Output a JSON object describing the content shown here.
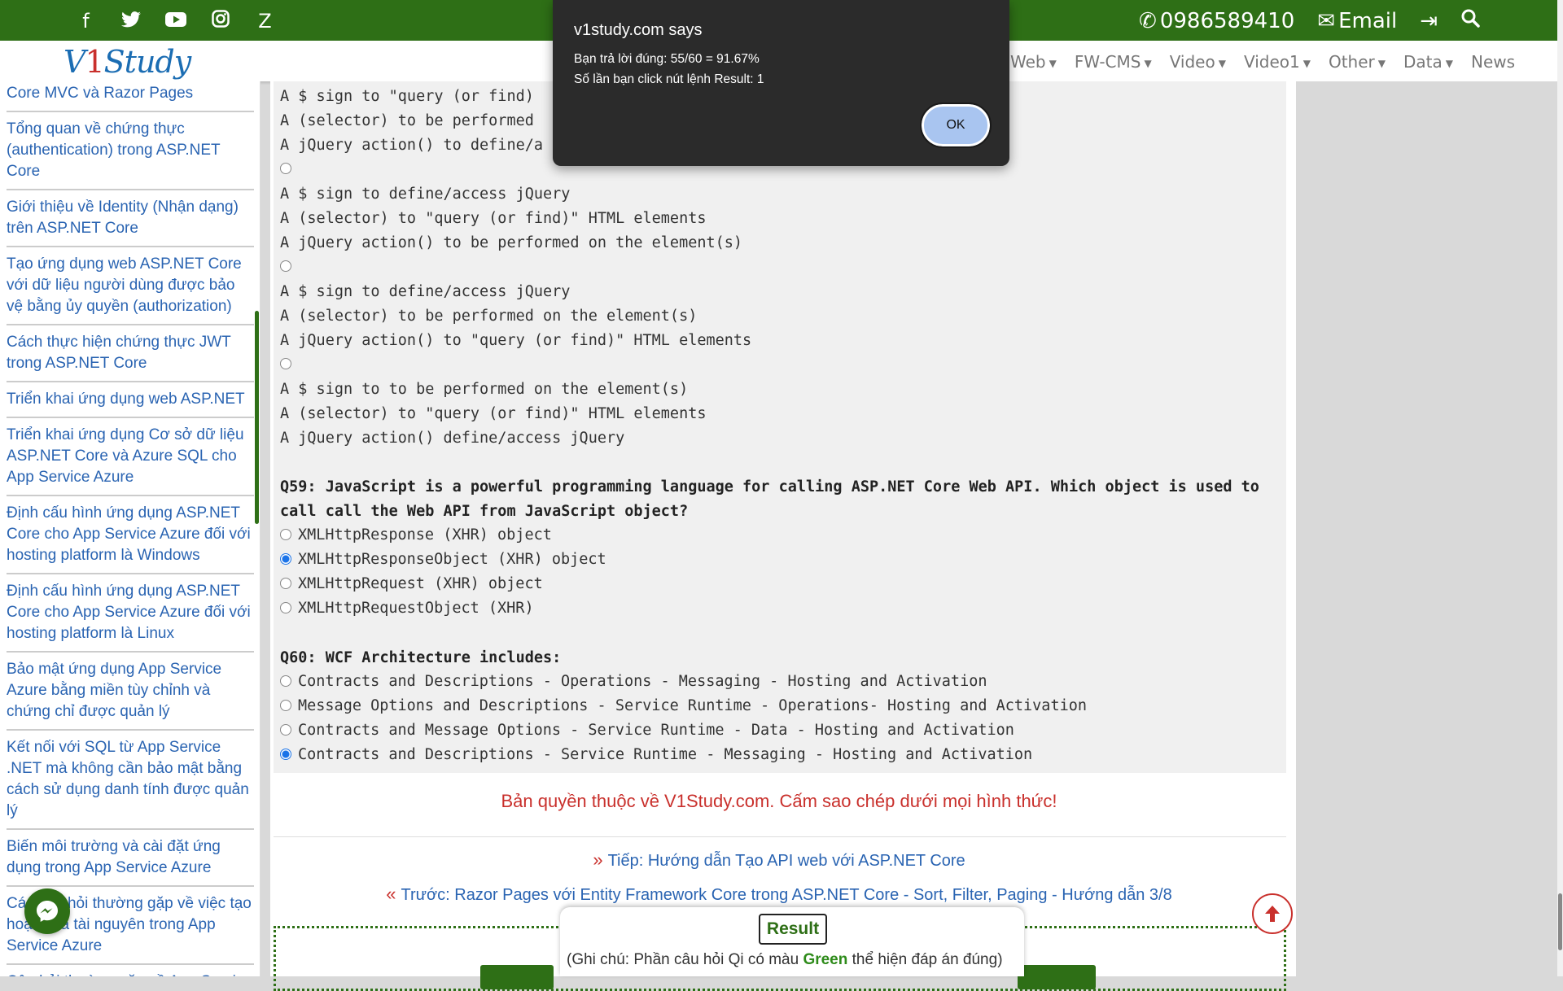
{
  "topbar": {
    "social_icons": [
      "facebook-icon",
      "twitter-icon",
      "youtube-icon",
      "instagram-icon",
      "zalo-icon"
    ],
    "social_glyphs": [
      "f",
      "🐦",
      "▶",
      "◎",
      "Z"
    ],
    "phone": "0986589410",
    "email": "Email"
  },
  "navbar": {
    "logo_v": "V",
    "logo_1": "1",
    "logo_study": "Study",
    "menu": [
      "Web",
      "FW-CMS",
      "Video",
      "Video1",
      "Other",
      "Data",
      "News"
    ]
  },
  "sidebar": {
    "items": [
      "Core MVC và Razor Pages",
      "Tổng quan về chứng thực (authentication) trong ASP.NET Core",
      "Giới thiệu về Identity (Nhận dạng) trên ASP.NET Core",
      "Tạo ứng dụng web ASP.NET Core với dữ liệu người dùng được bảo vệ bằng ủy quyền (authorization)",
      "Cách thực hiện chứng thực JWT trong ASP.NET Core",
      "Triển khai ứng dụng web ASP.NET",
      "Triển khai ứng dụng Cơ sở dữ liệu ASP.NET Core và Azure SQL cho App Service Azure",
      "Định cấu hình ứng dụng ASP.NET Core cho App Service Azure đối với hosting platform là Windows",
      "Định cấu hình ứng dụng ASP.NET Core cho App Service Azure đối với hosting platform là Linux",
      "Bảo mật ứng dụng App Service Azure bằng miền tùy chỉnh và chứng chỉ được quản lý",
      "Kết nối với SQL từ App Service .NET mà không cần bảo mật bằng cách sử dụng danh tính được quản lý",
      "Biến môi trường và cài đặt ứng dụng trong App Service Azure",
      "Các câu hỏi thường gặp về việc tạo hoặc xóa tài nguyên trong App Service Azure",
      "Câu hỏi thường gặp về App Service Azure trên Linux"
    ]
  },
  "quiz": {
    "top_lines": [
      "A $ sign to \"query (or find)",
      "A (selector) to be performed",
      "A jQuery action() to define/a"
    ],
    "option_b": [
      "A $ sign to define/access jQuery",
      "A (selector) to \"query (or find)\" HTML elements",
      "A jQuery action() to be performed on the element(s)"
    ],
    "option_c": [
      "A $ sign to define/access jQuery",
      "A (selector) to be performed on the element(s)",
      "A jQuery action() to \"query (or find)\" HTML elements"
    ],
    "option_d": [
      "A $ sign to to be performed on the element(s)",
      "A (selector) to \"query (or find)\" HTML elements",
      "A jQuery action() define/access jQuery"
    ],
    "q59": "Q59: JavaScript is a powerful programming language for calling ASP.NET Core Web API. Which object is used to call call the Web API from JavaScript object?",
    "q59_options": [
      "XMLHttpResponse (XHR) object",
      "XMLHttpResponseObject (XHR) object",
      "XMLHttpRequest (XHR) object",
      "XMLHttpRequestObject (XHR)"
    ],
    "q59_selected": 1,
    "q60": "Q60: WCF Architecture includes:",
    "q60_options": [
      "Contracts and Descriptions - Operations - Messaging - Hosting and Activation",
      "Message Options and Descriptions - Service Runtime - Operations- Hosting and Activation",
      "Contracts and Message Options - Service Runtime - Data - Hosting and Activation",
      "Contracts and Descriptions - Service Runtime - Messaging - Hosting and Activation"
    ],
    "q60_selected": 3
  },
  "footer": {
    "copyright": "Bản quyền thuộc về V1Study.com. Cấm sao chép dưới mọi hình thức!",
    "next_arrow": "»",
    "next": "Tiếp: Hướng dẫn Tạo API web với ASP.NET Core",
    "prev_arrow": "«",
    "prev": "Trước: Razor Pages với Entity Framework Core trong ASP.NET Core - Sort, Filter, Paging - Hướng dẫn 3/8"
  },
  "dialog": {
    "title": "v1study.com says",
    "line1": "Bạn trả lời đúng: 55/60 = 91.67%",
    "line2": "Số lần bạn click nút lệnh Result: 1",
    "ok": "OK"
  },
  "result": {
    "button": "Result",
    "note_pre": "(Ghi chú: Phần câu hỏi Qi có màu ",
    "note_green": "Green",
    "note_post": " thể hiện đáp án đúng)"
  }
}
